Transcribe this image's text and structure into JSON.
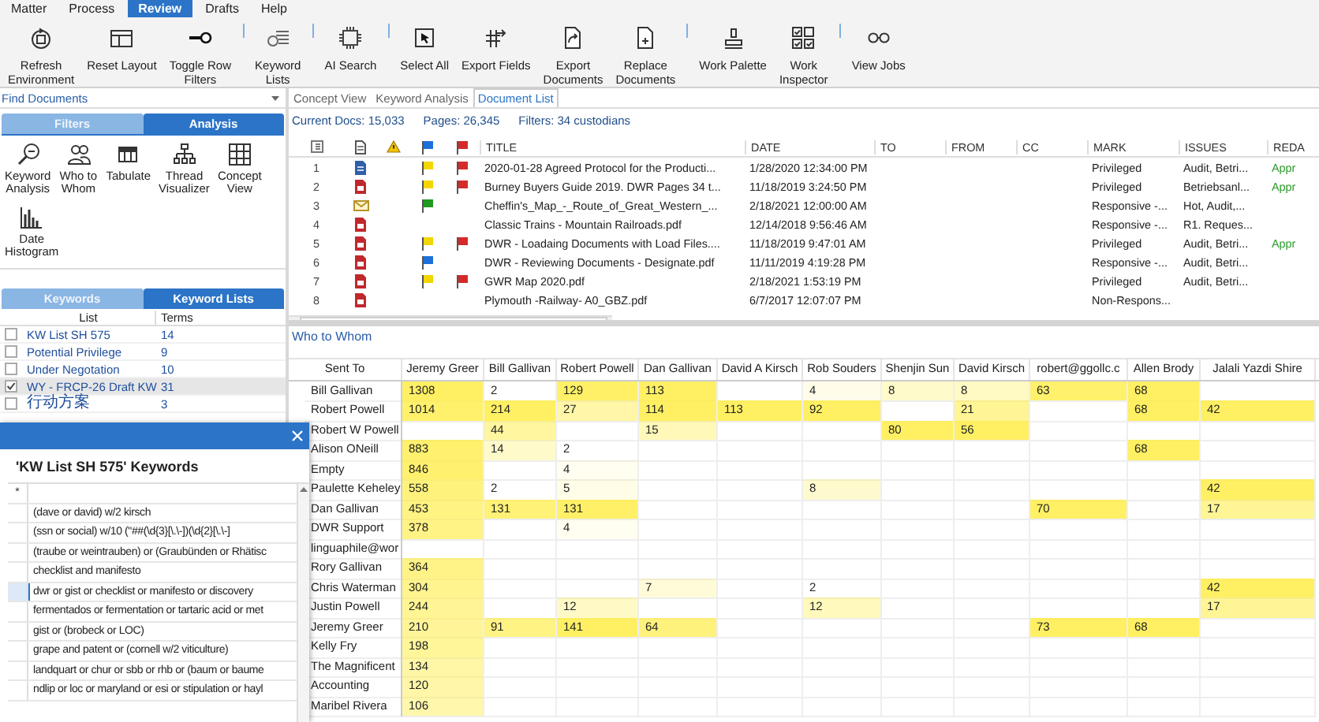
{
  "menu": [
    {
      "label": "Matter",
      "selected": false
    },
    {
      "label": "Process",
      "selected": false
    },
    {
      "label": "Review",
      "selected": true
    },
    {
      "label": "Drafts",
      "selected": false
    },
    {
      "label": "Help",
      "selected": false
    }
  ],
  "ribbon": {
    "groups": [
      [
        "Refresh\nEnvironment",
        "Reset Layout",
        "Toggle Row\nFilters"
      ],
      [
        "Keyword\nLists"
      ],
      [
        "AI Search"
      ],
      [
        "Select All",
        "Export Fields",
        "Export\nDocuments",
        "Replace\nDocuments"
      ],
      [
        "Work Palette",
        "Work\nInspector"
      ],
      [
        "View Jobs"
      ]
    ]
  },
  "find_documents": {
    "title": "Find Documents",
    "tabs": [
      {
        "label": "Filters",
        "selected": false
      },
      {
        "label": "Analysis",
        "selected": true
      }
    ],
    "tools": [
      "Keyword\nAnalysis",
      "Who to\nWhom",
      "Tabulate",
      "Thread\nVisualizer",
      "Concept\nView",
      "Date\nHistogram"
    ]
  },
  "keyword_panel": {
    "tabs": [
      {
        "label": "Keywords",
        "selected": false
      },
      {
        "label": "Keyword Lists",
        "selected": true
      }
    ],
    "columns": [
      "List",
      "Terms"
    ],
    "rows": [
      {
        "name": "KW List SH 575",
        "terms": "14",
        "checked": false,
        "selected": false
      },
      {
        "name": "Potential Privilege",
        "terms": "9",
        "checked": false,
        "selected": false
      },
      {
        "name": "Under Negotation",
        "terms": "10",
        "checked": false,
        "selected": false
      },
      {
        "name": "WY - FRCP-26 Draft KW",
        "terms": "31",
        "checked": true,
        "selected": true
      },
      {
        "name": "行动方案",
        "terms": "3",
        "checked": false,
        "selected": false
      }
    ]
  },
  "document_view": {
    "tabs": [
      {
        "label": "Concept View",
        "selected": false
      },
      {
        "label": "Keyword Analysis",
        "selected": false
      },
      {
        "label": "Document List",
        "selected": true
      }
    ],
    "stats": [
      "Current Docs: 15,033",
      "Pages: 26,345",
      "Filters: 34 custodians"
    ],
    "columns": [
      "TITLE",
      "DATE",
      "TO",
      "FROM",
      "CC",
      "MARK",
      "ISSUES",
      "REDA"
    ],
    "rows": [
      {
        "number": "1",
        "kind": "document",
        "color": "#f2d600",
        "flagged": true,
        "title": "2020-01-28 Agreed Protocol for the Producti...",
        "date": "1/28/2020 12:34:00 PM",
        "mark": "Privileged",
        "issues": "Audit, Betri...",
        "redaction": "Appr"
      },
      {
        "number": "2",
        "kind": "pdf",
        "color": "#f2d600",
        "flagged": true,
        "title": "Burney Buyers Guide 2019. DWR Pages 34 t...",
        "date": "11/18/2019 3:24:50 PM",
        "mark": "Privileged",
        "issues": "Betriebsanl...",
        "redaction": "Appr"
      },
      {
        "number": "3",
        "kind": "email",
        "color": "#1f9a1f",
        "flagged": false,
        "title": "Cheffin's_Map_-_Route_of_Great_Western_...",
        "date": "2/18/2021 12:00:00 AM",
        "mark": "Responsive -...",
        "issues": "Hot, Audit,..."
      },
      {
        "number": "4",
        "kind": "pdf",
        "flagged": false,
        "title": "Classic Trains - Mountain Railroads.pdf",
        "date": "12/14/2018 9:56:46 AM",
        "mark": "Responsive -...",
        "issues": "R1. Reques..."
      },
      {
        "number": "5",
        "kind": "pdf",
        "color": "#f2d600",
        "flagged": true,
        "title": "DWR - Loadaing Documents with Load Files....",
        "date": "11/18/2019 9:47:01 AM",
        "mark": "Privileged",
        "issues": "Audit, Betri...",
        "redaction": "Appr"
      },
      {
        "number": "6",
        "kind": "pdf",
        "color": "#1e6fd9",
        "flagged": false,
        "title": "DWR - Reviewing Documents - Designate.pdf",
        "date": "11/11/2019 4:19:28 PM",
        "mark": "Responsive -...",
        "issues": "Audit, Betri..."
      },
      {
        "number": "7",
        "kind": "pdf",
        "color": "#f2d600",
        "flagged": true,
        "title": "GWR Map 2020.pdf",
        "date": "2/18/2021 1:53:19 PM",
        "mark": "Privileged",
        "issues": "Audit, Betri..."
      },
      {
        "number": "8",
        "kind": "pdf",
        "flagged": false,
        "title": "Plymouth -Railway- A0_GBZ.pdf",
        "date": "6/7/2017 12:07:07 PM",
        "mark": "Non-Respons..."
      }
    ]
  },
  "who_to_whom": {
    "title": "Who to Whom",
    "corner": "Sent To",
    "columns": [
      "Jeremy Greer",
      "Bill Gallivan",
      "Robert Powell",
      "Dan Gallivan",
      "David A Kirsch",
      "Rob Souders",
      "Shenjin Sun",
      "David Kirsch",
      "robert@ggollc.c",
      "Allen Brody",
      "Jalali Yazdi Shire"
    ],
    "rows": [
      {
        "name": "Bill Gallivan",
        "cells": [
          {
            "value": "1308"
          },
          {
            "value": "2"
          },
          {
            "value": "129"
          },
          {
            "value": "113"
          },
          {
            "empty": true
          },
          {
            "value": "4"
          },
          {
            "value": "8"
          },
          {
            "value": "8"
          },
          {
            "value": "63"
          },
          {
            "value": "68"
          },
          {
            "empty": true
          }
        ]
      },
      {
        "name": "Robert Powell",
        "cells": [
          {
            "value": "1014"
          },
          {
            "value": "214"
          },
          {
            "value": "27"
          },
          {
            "value": "114"
          },
          {
            "value": "113"
          },
          {
            "value": "92"
          },
          {
            "empty": true
          },
          {
            "value": "21"
          },
          {
            "empty": true
          },
          {
            "value": "68"
          },
          {
            "value": "42"
          }
        ]
      },
      {
        "name": "Robert W Powell",
        "cells": [
          {
            "empty": true
          },
          {
            "value": "44"
          },
          {
            "empty": true
          },
          {
            "value": "15"
          },
          {
            "empty": true
          },
          {
            "empty": true
          },
          {
            "value": "80"
          },
          {
            "value": "56"
          },
          {
            "empty": true
          },
          {
            "empty": true
          },
          {
            "empty": true
          }
        ]
      },
      {
        "name": "Alison ONeill",
        "cells": [
          {
            "value": "883"
          },
          {
            "value": "14"
          },
          {
            "value": "2"
          },
          {
            "empty": true
          },
          {
            "empty": true
          },
          {
            "empty": true
          },
          {
            "empty": true
          },
          {
            "empty": true
          },
          {
            "empty": true
          },
          {
            "value": "68"
          },
          {
            "empty": true
          }
        ]
      },
      {
        "name": "Empty",
        "cells": [
          {
            "value": "846"
          },
          {
            "empty": true
          },
          {
            "value": "4"
          },
          {
            "empty": true
          },
          {
            "empty": true
          },
          {
            "empty": true
          },
          {
            "empty": true
          },
          {
            "empty": true
          },
          {
            "empty": true
          },
          {
            "empty": true
          },
          {
            "empty": true
          }
        ]
      },
      {
        "name": "Paulette Keheley",
        "cells": [
          {
            "value": "558"
          },
          {
            "value": "2"
          },
          {
            "value": "5"
          },
          {
            "empty": true
          },
          {
            "empty": true
          },
          {
            "value": "8"
          },
          {
            "empty": true
          },
          {
            "empty": true
          },
          {
            "empty": true
          },
          {
            "empty": true
          },
          {
            "value": "42"
          }
        ]
      },
      {
        "name": "Dan Gallivan",
        "cells": [
          {
            "value": "453"
          },
          {
            "value": "131"
          },
          {
            "value": "131"
          },
          {
            "empty": true
          },
          {
            "empty": true
          },
          {
            "empty": true
          },
          {
            "empty": true
          },
          {
            "empty": true
          },
          {
            "value": "70"
          },
          {
            "empty": true
          },
          {
            "value": "17"
          }
        ]
      },
      {
        "name": "DWR Support",
        "cells": [
          {
            "value": "378"
          },
          {
            "empty": true
          },
          {
            "value": "4"
          },
          {
            "empty": true
          },
          {
            "empty": true
          },
          {
            "empty": true
          },
          {
            "empty": true
          },
          {
            "empty": true
          },
          {
            "empty": true
          },
          {
            "empty": true
          },
          {
            "empty": true
          }
        ]
      },
      {
        "name": "linguaphile@wor",
        "cells": [
          {
            "empty": true
          },
          {
            "empty": true
          },
          {
            "empty": true
          },
          {
            "empty": true
          },
          {
            "empty": true
          },
          {
            "empty": true
          },
          {
            "empty": true
          },
          {
            "empty": true
          },
          {
            "empty": true
          },
          {
            "empty": true
          },
          {
            "empty": true
          }
        ]
      },
      {
        "name": "Rory Gallivan",
        "cells": [
          {
            "value": "364"
          },
          {
            "empty": true
          },
          {
            "empty": true
          },
          {
            "empty": true
          },
          {
            "empty": true
          },
          {
            "empty": true
          },
          {
            "empty": true
          },
          {
            "empty": true
          },
          {
            "empty": true
          },
          {
            "empty": true
          },
          {
            "empty": true
          }
        ]
      },
      {
        "name": "Chris Waterman",
        "cells": [
          {
            "value": "304"
          },
          {
            "empty": true
          },
          {
            "empty": true
          },
          {
            "value": "7"
          },
          {
            "empty": true
          },
          {
            "value": "2"
          },
          {
            "empty": true
          },
          {
            "empty": true
          },
          {
            "empty": true
          },
          {
            "empty": true
          },
          {
            "value": "42"
          }
        ]
      },
      {
        "name": "Justin Powell",
        "cells": [
          {
            "value": "244"
          },
          {
            "empty": true
          },
          {
            "value": "12"
          },
          {
            "empty": true
          },
          {
            "empty": true
          },
          {
            "value": "12"
          },
          {
            "empty": true
          },
          {
            "empty": true
          },
          {
            "empty": true
          },
          {
            "empty": true
          },
          {
            "value": "17"
          }
        ]
      },
      {
        "name": "Jeremy Greer",
        "cells": [
          {
            "value": "210"
          },
          {
            "value": "91"
          },
          {
            "value": "141"
          },
          {
            "value": "64"
          },
          {
            "empty": true
          },
          {
            "empty": true
          },
          {
            "empty": true
          },
          {
            "empty": true
          },
          {
            "value": "73"
          },
          {
            "value": "68"
          },
          {
            "empty": true
          }
        ]
      },
      {
        "name": "Kelly Fry",
        "cells": [
          {
            "value": "198"
          },
          {
            "empty": true
          },
          {
            "empty": true
          },
          {
            "empty": true
          },
          {
            "empty": true
          },
          {
            "empty": true
          },
          {
            "empty": true
          },
          {
            "empty": true
          },
          {
            "empty": true
          },
          {
            "empty": true
          },
          {
            "empty": true
          }
        ]
      },
      {
        "name": "The Magnificent",
        "cells": [
          {
            "value": "134"
          },
          {
            "empty": true
          },
          {
            "empty": true
          },
          {
            "empty": true
          },
          {
            "empty": true
          },
          {
            "empty": true
          },
          {
            "empty": true
          },
          {
            "empty": true
          },
          {
            "empty": true
          },
          {
            "empty": true
          },
          {
            "empty": true
          }
        ]
      },
      {
        "name": "Accounting",
        "cells": [
          {
            "value": "120"
          },
          {
            "empty": true
          },
          {
            "empty": true
          },
          {
            "empty": true
          },
          {
            "empty": true
          },
          {
            "empty": true
          },
          {
            "empty": true
          },
          {
            "empty": true
          },
          {
            "empty": true
          },
          {
            "empty": true
          },
          {
            "empty": true
          }
        ]
      },
      {
        "name": "Maribel Rivera",
        "cells": [
          {
            "value": "106"
          },
          {
            "empty": true
          },
          {
            "empty": true
          },
          {
            "empty": true
          },
          {
            "empty": true
          },
          {
            "empty": true
          },
          {
            "empty": true
          },
          {
            "empty": true
          },
          {
            "empty": true
          },
          {
            "empty": true
          },
          {
            "empty": true
          }
        ]
      }
    ]
  },
  "keyword_dialog": {
    "title": "'KW List SH 575' Keywords",
    "new_row_marker": "*",
    "keywords": [
      {
        "text": "(dave or david) w/2 kirsch",
        "selected": false
      },
      {
        "text": "(ssn or social) w/10 (\"##(\\d{3}[\\.\\-])(\\d{2}[\\.\\-]",
        "selected": false
      },
      {
        "text": "(traube or weintrauben) or (Graubünden or Rhätisc",
        "selected": false
      },
      {
        "text": "checklist and manifesto",
        "selected": false
      },
      {
        "text": "dwr or gist or checklist or manifesto or discovery",
        "selected": true
      },
      {
        "text": "fermentados or fermentation or tartaric acid or met",
        "selected": false
      },
      {
        "text": "gist or (brobeck or LOC)",
        "selected": false
      },
      {
        "text": "grape and patent or (cornell w/2 viticulture)",
        "selected": false
      },
      {
        "text": "landquart or chur or sbb or rhb or (baum or baume",
        "selected": false
      },
      {
        "text": "ndlip or loc or maryland or esi or stipulation or hayl",
        "selected": false
      }
    ]
  }
}
